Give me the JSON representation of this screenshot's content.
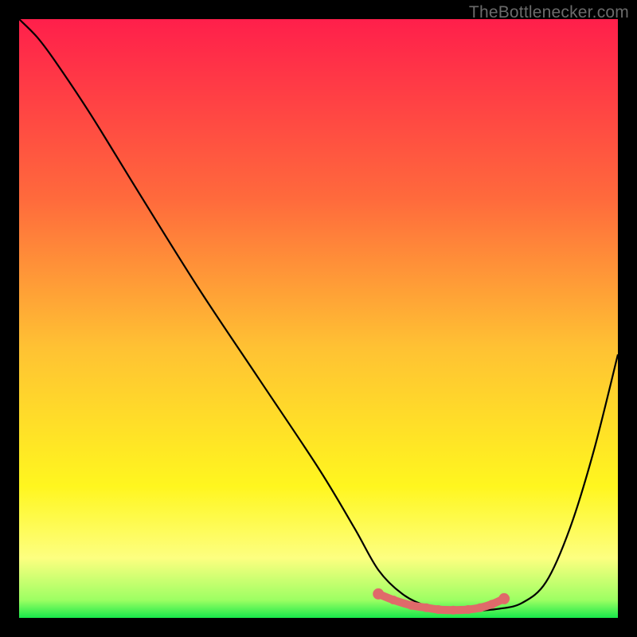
{
  "watermark": "TheBottlenecker.com",
  "chart_data": {
    "type": "line",
    "title": "",
    "xlabel": "",
    "ylabel": "",
    "xlim": [
      0,
      100
    ],
    "ylim": [
      0,
      100
    ],
    "gradient_stops": [
      {
        "offset": 0,
        "color": "#ff1f4b"
      },
      {
        "offset": 30,
        "color": "#ff6a3c"
      },
      {
        "offset": 55,
        "color": "#ffc233"
      },
      {
        "offset": 78,
        "color": "#fff61f"
      },
      {
        "offset": 90,
        "color": "#fdff80"
      },
      {
        "offset": 97,
        "color": "#9dff63"
      },
      {
        "offset": 100,
        "color": "#17e84a"
      }
    ],
    "curve": {
      "name": "bottleneck-curve",
      "x": [
        0,
        3,
        6,
        12,
        20,
        30,
        40,
        50,
        56,
        60,
        64,
        68,
        72,
        76,
        80,
        84,
        88,
        92,
        96,
        100
      ],
      "y": [
        100,
        97,
        93,
        84,
        71,
        55,
        40,
        25,
        15,
        8,
        4,
        2,
        1.3,
        1.2,
        1.5,
        2.5,
        6,
        15,
        28,
        44
      ]
    },
    "marker_band": {
      "name": "optimal-range",
      "color": "#e06a6a",
      "x": [
        60,
        62.5,
        65.5,
        68,
        70,
        72.5,
        75,
        77,
        79,
        81
      ],
      "y": [
        4.0,
        3.0,
        2.1,
        1.7,
        1.4,
        1.3,
        1.4,
        1.7,
        2.3,
        3.2
      ]
    }
  }
}
